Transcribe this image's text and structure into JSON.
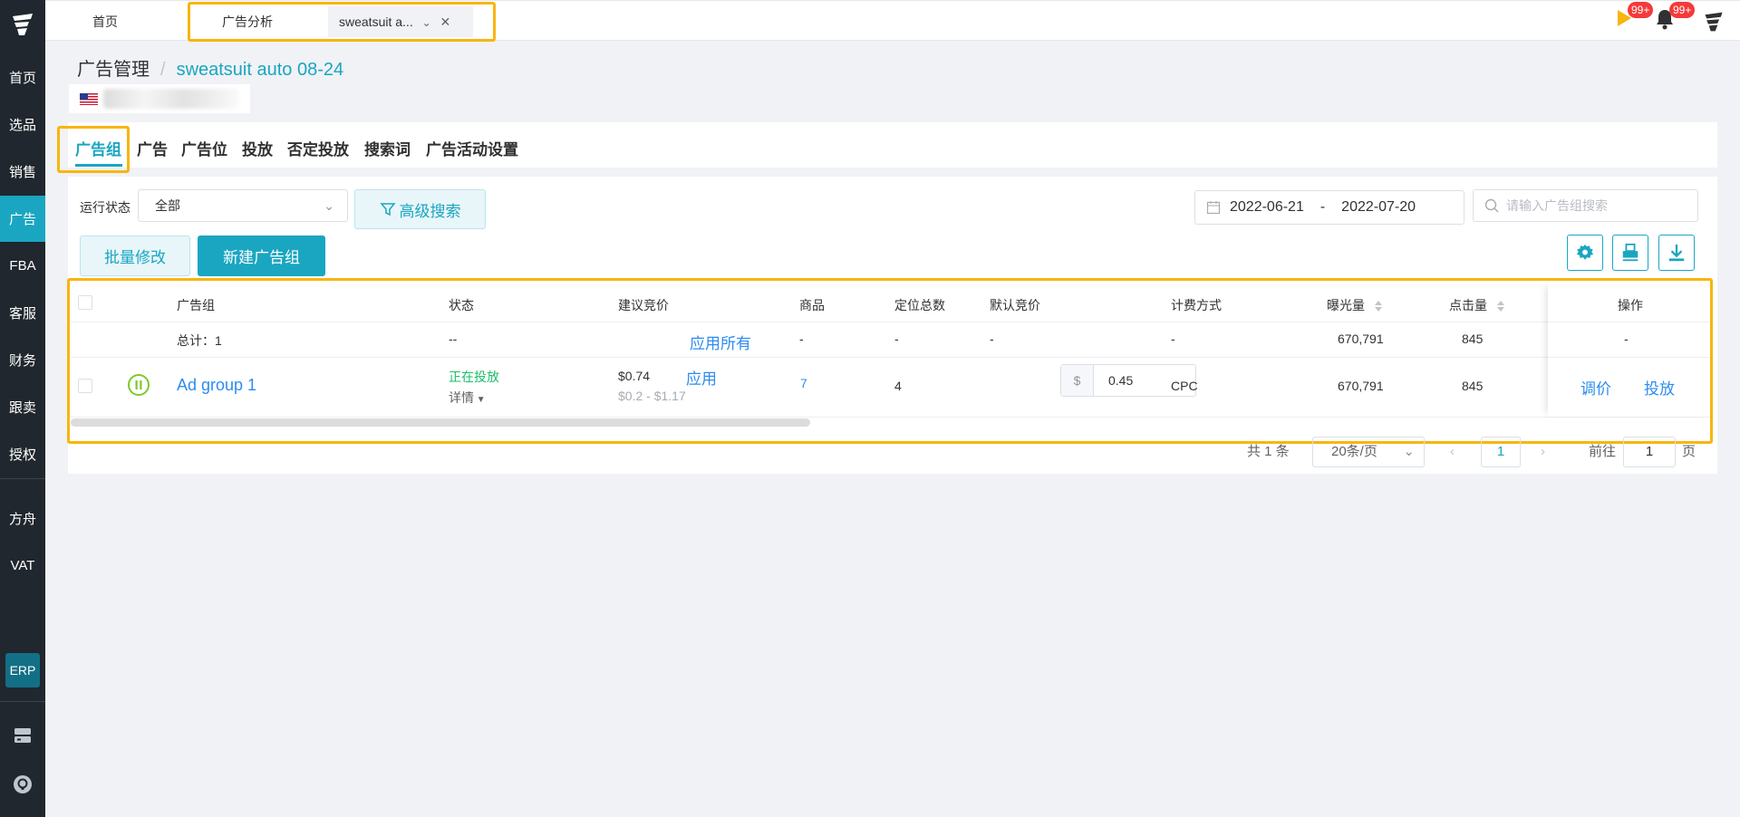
{
  "sidebar": {
    "items": [
      {
        "label": "首页"
      },
      {
        "label": "选品"
      },
      {
        "label": "销售"
      },
      {
        "label": "广告"
      },
      {
        "label": "FBA"
      },
      {
        "label": "客服"
      },
      {
        "label": "财务"
      },
      {
        "label": "跟卖"
      },
      {
        "label": "授权"
      },
      {
        "label": "方舟"
      },
      {
        "label": "VAT"
      }
    ],
    "erp_label": "ERP"
  },
  "topbar": {
    "tabs": [
      {
        "label": "首页"
      },
      {
        "label": "广告分析"
      },
      {
        "label": "sweatsuit a..."
      }
    ],
    "notif_badge_1": "99+",
    "notif_badge_2": "99+"
  },
  "breadcrumb": {
    "parent": "广告管理",
    "separator": "/",
    "current": "sweatsuit auto 08-24"
  },
  "sub_tabs": [
    {
      "label": "广告组"
    },
    {
      "label": "广告"
    },
    {
      "label": "广告位"
    },
    {
      "label": "投放"
    },
    {
      "label": "否定投放"
    },
    {
      "label": "搜索词"
    },
    {
      "label": "广告活动设置"
    }
  ],
  "filters": {
    "status_label": "运行状态",
    "status_value": "全部",
    "advanced_search": "高级搜索",
    "date_start": "2022-06-21",
    "date_sep": "-",
    "date_end": "2022-07-20",
    "search_placeholder": "请输入广告组搜索"
  },
  "actions": {
    "batch_edit": "批量修改",
    "new_group": "新建广告组"
  },
  "table": {
    "headers": {
      "group": "广告组",
      "status": "状态",
      "suggested_bid": "建议竞价",
      "products": "商品",
      "targets": "定位总数",
      "default_bid": "默认竞价",
      "billing": "计费方式",
      "impressions": "曝光量",
      "clicks": "点击量",
      "ops": "操作"
    },
    "total_row": {
      "label": "总计：1",
      "status": "--",
      "apply_all": "应用所有",
      "products": "-",
      "targets": "-",
      "default_bid": "-",
      "billing": "-",
      "impressions": "670,791",
      "clicks": "845",
      "ops": "-"
    },
    "rows": [
      {
        "name": "Ad group 1",
        "status": "正在投放",
        "detail": "详情",
        "bid": "$0.74",
        "bid_range": "$0.2 - $1.17",
        "apply": "应用",
        "products": "7",
        "targets": "4",
        "currency": "$",
        "default_bid": "0.45",
        "billing": "CPC",
        "impressions": "670,791",
        "clicks": "845",
        "op_adjust": "调价",
        "op_target": "投放"
      }
    ]
  },
  "pagination": {
    "total": "共 1 条",
    "page_size": "20条/页",
    "current": "1",
    "goto_label": "前往",
    "goto_value": "1",
    "page_suffix": "页"
  },
  "colors": {
    "accent": "#1aa6c1",
    "sidebar": "#20272e",
    "highlight": "#f8b50e",
    "running": "#19be6b",
    "link": "#2d8cf0"
  }
}
